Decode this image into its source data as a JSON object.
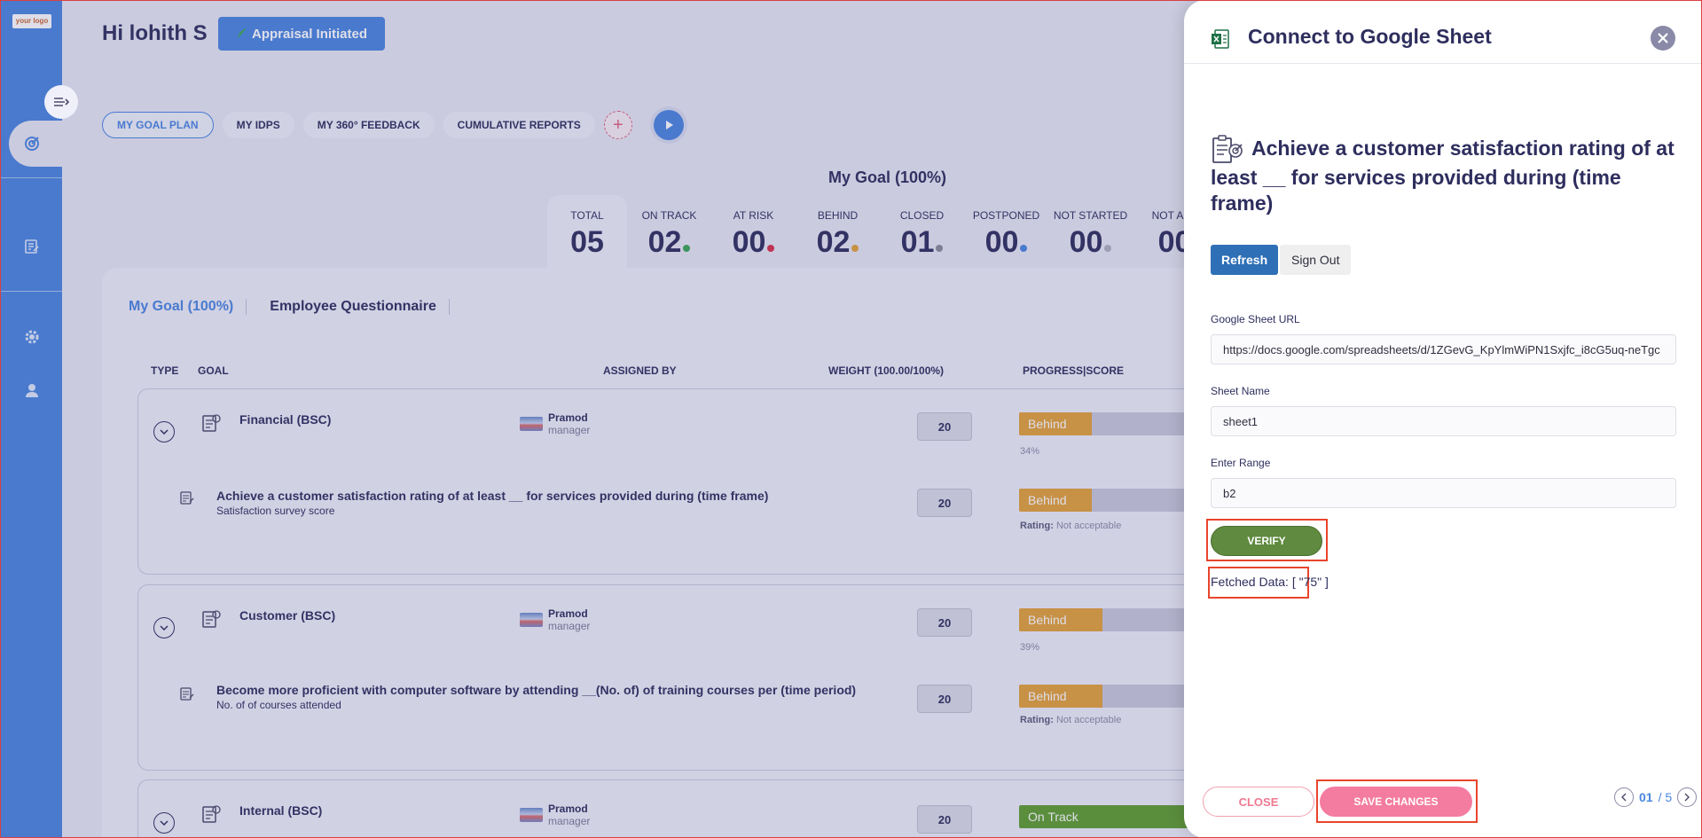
{
  "sidebar": {
    "logo": "your logo"
  },
  "header": {
    "greeting": "Hi lohith S",
    "appraisal_status": "Appraisal Initiated"
  },
  "tabs": [
    {
      "label": "MY GOAL PLAN",
      "active": true
    },
    {
      "label": "MY IDPS"
    },
    {
      "label": "MY 360° FEEDBACK"
    },
    {
      "label": "CUMULATIVE REPORTS"
    }
  ],
  "goal_heading": "My Goal (100%)",
  "stats": [
    {
      "label": "TOTAL",
      "value": "05",
      "color": ""
    },
    {
      "label": "ON TRACK",
      "value": "02",
      "color": "#3aa655"
    },
    {
      "label": "AT RISK",
      "value": "00",
      "color": "#d9304a"
    },
    {
      "label": "BEHIND",
      "value": "02",
      "color": "#e3a23a"
    },
    {
      "label": "CLOSED",
      "value": "01",
      "color": "#8a8a9a"
    },
    {
      "label": "POSTPONED",
      "value": "00",
      "color": "#4a86e0"
    },
    {
      "label": "NOT STARTED",
      "value": "00",
      "color": "#b0b0c0"
    },
    {
      "label": "NOT APP",
      "value": "00",
      "color": ""
    }
  ],
  "subtabs": [
    "My Goal (100%)",
    "Employee Questionnaire"
  ],
  "table_headers": {
    "type": "TYPE",
    "goal": "GOAL",
    "assigned_by": "ASSIGNED BY",
    "weight": "WEIGHT (100.00/100%)",
    "progress": "PROGRESS|SCORE"
  },
  "goals": [
    {
      "title": "Financial (BSC)",
      "assignee": "Pramod",
      "role": "manager",
      "weight": "20",
      "status": "Behind",
      "progress_pct": 34,
      "pct_label": "34%",
      "sub": {
        "title": "Achieve a customer satisfaction rating of at least __ for services provided during (time frame)",
        "desc": "Satisfaction survey score",
        "weight": "20",
        "status": "Behind",
        "rating_label": "Rating:",
        "rating": "Not acceptable"
      }
    },
    {
      "title": "Customer (BSC)",
      "assignee": "Pramod",
      "role": "manager",
      "weight": "20",
      "status": "Behind",
      "progress_pct": 39,
      "pct_label": "39%",
      "sub": {
        "title": "Become more proficient with computer software by attending __(No. of) of training courses per (time period)",
        "desc": "No. of of courses attended",
        "weight": "20",
        "status": "Behind",
        "rating_label": "Rating:",
        "rating": "Not acceptable"
      }
    },
    {
      "title": "Internal (BSC)",
      "assignee": "Pramod",
      "role": "manager",
      "weight": "20",
      "status": "On Track"
    }
  ],
  "panel": {
    "title": "Connect to Google Sheet",
    "goal_title": "Achieve a customer satisfaction rating of at least __ for services provided during (time frame)",
    "refresh_label": "Refresh",
    "signout_label": "Sign Out",
    "url_label": "Google Sheet URL",
    "url_value": "https://docs.google.com/spreadsheets/d/1ZGevG_KpYlmWiPN1Sxjfc_i8cG5uq-neTgc",
    "sheet_label": "Sheet Name",
    "sheet_value": "sheet1",
    "range_label": "Enter Range",
    "range_value": "b2",
    "verify_label": "VERIFY",
    "fetched": "Fetched Data: [ \"75\" ]",
    "close_label": "CLOSE",
    "save_label": "SAVE CHANGES",
    "pager_current": "01",
    "pager_total": "/ 5"
  },
  "colors": {
    "accent": "#4a86e0",
    "behind": "#e3a23a",
    "on_track": "#5f9e2f",
    "save": "#f47ca0",
    "verify": "#5f8a3f",
    "highlight": "#e8452c"
  }
}
